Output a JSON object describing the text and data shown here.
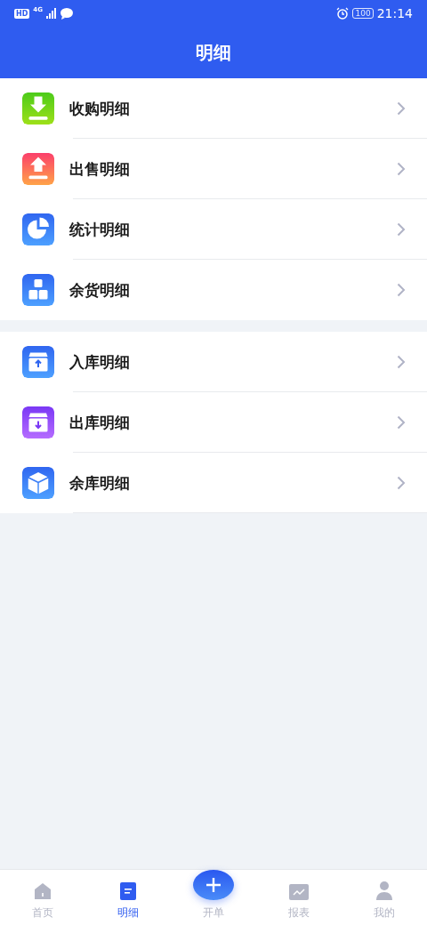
{
  "status_bar": {
    "hd": "HD",
    "network": "4G",
    "battery": "100",
    "time": "21:14"
  },
  "header": {
    "title": "明细"
  },
  "groups": [
    {
      "items": [
        {
          "label": "收购明细",
          "kind": "download"
        },
        {
          "label": "出售明细",
          "kind": "upload"
        },
        {
          "label": "统计明细",
          "kind": "pie"
        },
        {
          "label": "余货明细",
          "kind": "blocks"
        }
      ]
    },
    {
      "items": [
        {
          "label": "入库明细",
          "kind": "box-in"
        },
        {
          "label": "出库明细",
          "kind": "box-out"
        },
        {
          "label": "余库明细",
          "kind": "cube"
        }
      ]
    }
  ],
  "tab_bar": [
    {
      "label": "首页",
      "kind": "home",
      "selected": false
    },
    {
      "label": "明细",
      "kind": "doc",
      "selected": true
    },
    {
      "label": "开单",
      "kind": "add",
      "selected": false
    },
    {
      "label": "报表",
      "kind": "chart",
      "selected": false
    },
    {
      "label": "我的",
      "kind": "user",
      "selected": false
    }
  ]
}
